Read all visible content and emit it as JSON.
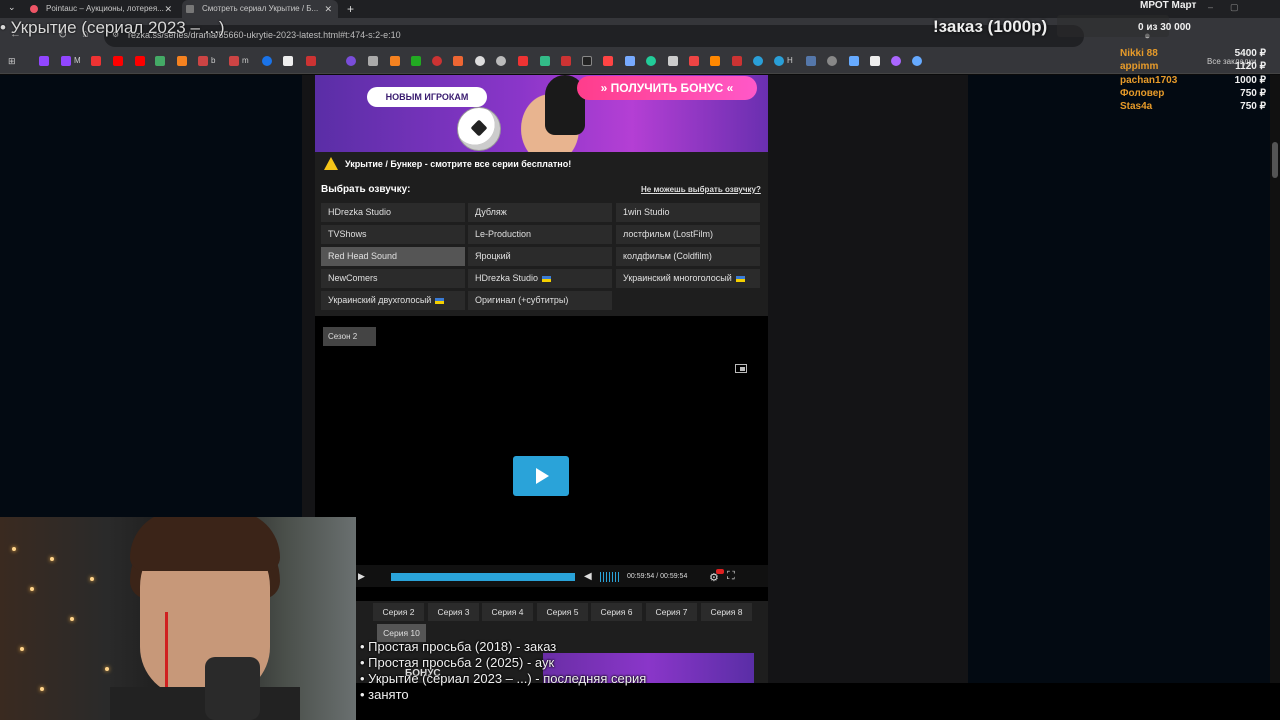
{
  "browser": {
    "tabs": [
      {
        "title": "Pointauc – Аукционы, лотерея..."
      },
      {
        "title": "Смотреть сериал Укрытие / Б..."
      }
    ],
    "url": "rezka.ss/series/drama/55660-ukrytie-2023-latest.html#t:474-s:2-e:10",
    "bookmarks": [
      "M",
      "b",
      "m",
      "H"
    ],
    "all_bookmarks": "Все закладки"
  },
  "site": {
    "banner": {
      "subtitle": "НОВЫМ ИГРОКАМ",
      "button": "» ПОЛУЧИТЬ БОНУС «"
    },
    "notice": "Укрытие / Бункер - смотрите все серии бесплатно!",
    "voice_title": "Выбрать озвучку:",
    "voice_help": "Не можешь выбрать озвучку?",
    "voices": [
      {
        "label": "HDrezka Studio",
        "flag": false,
        "active": false
      },
      {
        "label": "Дубляж",
        "flag": false,
        "active": false
      },
      {
        "label": "1win Studio",
        "flag": false,
        "active": false
      },
      {
        "label": "TVShows",
        "flag": false,
        "active": false
      },
      {
        "label": "Le-Production",
        "flag": false,
        "active": false
      },
      {
        "label": "лостфильм (LostFilm)",
        "flag": false,
        "active": false
      },
      {
        "label": "Red Head Sound",
        "flag": false,
        "active": true
      },
      {
        "label": "Яроцкий",
        "flag": false,
        "active": false
      },
      {
        "label": "колдфильм (Coldfilm)",
        "flag": false,
        "active": false
      },
      {
        "label": "NewComers",
        "flag": false,
        "active": false
      },
      {
        "label": "HDrezka Studio",
        "flag": true,
        "active": false
      },
      {
        "label": "Украинский многоголосый",
        "flag": true,
        "active": false
      },
      {
        "label": "Украинский двухголосый",
        "flag": true,
        "active": false
      },
      {
        "label": "Оригинал (+субтитры)",
        "flag": false,
        "active": false
      }
    ],
    "season": "Сезон 2",
    "player": {
      "time": "00:59:54 / 00:59:54",
      "progress": 1.0
    },
    "episodes": [
      {
        "label": "Серия 2",
        "active": false
      },
      {
        "label": "Серия 3",
        "active": false
      },
      {
        "label": "Серия 4",
        "active": false
      },
      {
        "label": "Серия 5",
        "active": false
      },
      {
        "label": "Серия 6",
        "active": false
      },
      {
        "label": "Серия 7",
        "active": false
      },
      {
        "label": "Серия 8",
        "active": false
      },
      {
        "label": "Серия 10",
        "active": true
      }
    ],
    "banner2": "БОНУС"
  },
  "overlay": {
    "title": "• Укрытие (сериал 2023 – ...)",
    "order": "!заказ (1000р)",
    "mrot": "МРОТ Март",
    "count": "0  из 30 000",
    "donations": [
      {
        "name": "Nikki 88",
        "amount": "5400 ₽"
      },
      {
        "name": "appimm",
        "amount": "1120 ₽"
      },
      {
        "name": "pachan1703",
        "amount": "1000 ₽"
      },
      {
        "name": "Фоловер",
        "amount": "750 ₽"
      },
      {
        "name": "Stas4a",
        "amount": "750 ₽"
      }
    ],
    "queue": [
      "• Простая просьба (2018) - заказ",
      "• Простая просьба 2 (2025) - аук",
      "• Укрытие (сериал 2023 – ...) - последняя серия",
      "• занято"
    ]
  },
  "colors": {
    "accent": "#2aa3d9",
    "donor": "#e79b2a",
    "warning": "#f5c518"
  }
}
